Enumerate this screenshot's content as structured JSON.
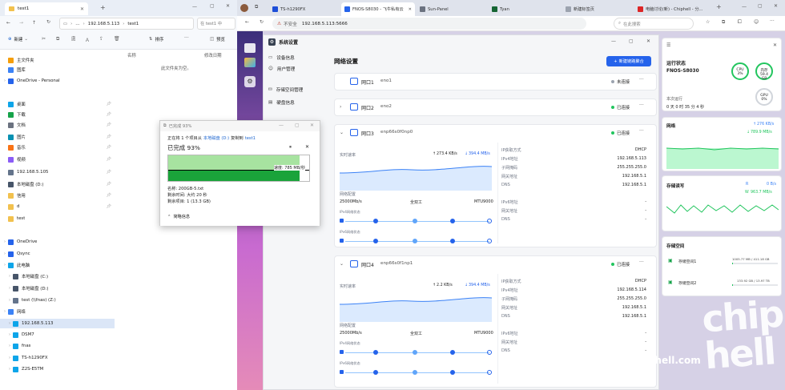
{
  "explorer": {
    "tab_title": "test1",
    "path": [
      "192.168.5.113",
      "test1"
    ],
    "search_placeholder": "在 test1 中",
    "new_label": "新建",
    "sort_label": "排序",
    "view_label": "查看",
    "preview_label": "预览",
    "col_name": "名称",
    "col_modified": "修改日期",
    "empty_text": "此文件夹为空。",
    "nav": [
      {
        "label": "主文件夹",
        "icon": "home-icon",
        "pin": false,
        "chev": false
      },
      {
        "label": "图库",
        "icon": "gallery-icon",
        "pin": false,
        "chev": false
      },
      {
        "label": "OneDrive - Personal",
        "icon": "cloud-icon",
        "pin": false,
        "chev": true
      },
      {
        "label": "桌面",
        "icon": "desktop-icon",
        "pin": true,
        "chev": false
      },
      {
        "label": "下载",
        "icon": "download-icon",
        "pin": true,
        "chev": false
      },
      {
        "label": "文档",
        "icon": "document-icon",
        "pin": true,
        "chev": false
      },
      {
        "label": "图片",
        "icon": "pictures-icon",
        "pin": true,
        "chev": false
      },
      {
        "label": "音乐",
        "icon": "music-icon",
        "pin": true,
        "chev": false
      },
      {
        "label": "视频",
        "icon": "video-icon",
        "pin": true,
        "chev": false
      },
      {
        "label": "192.168.5.105",
        "icon": "network-drive-icon",
        "pin": true,
        "chev": false
      },
      {
        "label": "本地磁盘 (D:)",
        "icon": "drive-icon",
        "pin": true,
        "chev": false
      },
      {
        "label": "信用",
        "icon": "folder-icon",
        "pin": true,
        "chev": false
      },
      {
        "label": "d",
        "icon": "folder-icon",
        "pin": true,
        "chev": false
      },
      {
        "label": "test",
        "icon": "folder-icon",
        "pin": false,
        "chev": false
      },
      {
        "label": "OneDrive",
        "icon": "cloud-icon",
        "pin": false,
        "chev": true
      },
      {
        "label": "Qsync",
        "icon": "sync-icon",
        "pin": false,
        "chev": true
      },
      {
        "label": "此电脑",
        "icon": "pc-icon",
        "pin": false,
        "chev": true
      },
      {
        "label": "本地磁盘 (C:)",
        "icon": "drive-icon",
        "pin": false,
        "chev": true
      },
      {
        "label": "本地磁盘 (D:)",
        "icon": "drive-icon",
        "pin": false,
        "chev": true
      },
      {
        "label": "test (\\\\fnas) (Z:)",
        "icon": "network-drive-icon",
        "pin": false,
        "chev": true
      },
      {
        "label": "网络",
        "icon": "network-icon",
        "pin": false,
        "chev": true
      },
      {
        "label": "192.168.5.113",
        "icon": "pc-icon",
        "pin": false,
        "chev": true
      },
      {
        "label": "DSM7",
        "icon": "pc-icon",
        "pin": false,
        "chev": true
      },
      {
        "label": "fnas",
        "icon": "pc-icon",
        "pin": false,
        "chev": true
      },
      {
        "label": "TS-h1290FX",
        "icon": "pc-icon",
        "pin": false,
        "chev": true
      },
      {
        "label": "Z2S-E5TM",
        "icon": "pc-icon",
        "pin": false,
        "chev": true
      }
    ]
  },
  "copy": {
    "title": "已完成 93%",
    "line1_pre": "正在将 1 个项目从",
    "line1_src": "本地磁盘 (D:)",
    "line1_mid": "复制到",
    "line1_dst": "test1",
    "done": "已完成 93%",
    "progress": 0.93,
    "speed": "速度: 785 MB/秒",
    "name": "名称: 200GB-5.txt",
    "remain_time": "剩余时间: 大约 20 秒",
    "remain_items": "剩余项目: 1 (13.3 GB)",
    "less": "简略信息"
  },
  "browser": {
    "tabs": [
      "TS-h1290FX",
      "FNOS-S8030 - 飞牛私有云",
      "Sun-Panel",
      "Tyan",
      "新建标签页",
      "电脑讨论(新) - Chiphell - 分..."
    ],
    "insecure": "不安全",
    "url": "192.168.5.113:5666",
    "search_placeholder": "在此搜索"
  },
  "settings": {
    "title": "系统设置",
    "menu": [
      "设备信息",
      "用户管理",
      "存储空间管理",
      "硬盘信息"
    ],
    "section": "网络设置",
    "new_bond": "新建链路聚合",
    "ports": [
      {
        "name": "网口1",
        "dev": "eno1",
        "status": "未连接",
        "status_color": "#9ca3af"
      },
      {
        "name": "网口2",
        "dev": "eno2",
        "status": "已连接",
        "status_color": "#22c55e"
      },
      {
        "name": "网口3",
        "dev": "enp66s0f0np0",
        "status": "已连接",
        "status_color": "#22c55e"
      },
      {
        "name": "网口4",
        "dev": "enp66s0f1np1",
        "status": "已连接",
        "status_color": "#22c55e"
      }
    ],
    "p3": {
      "rt": "实时速率",
      "up": "273.4 KB/s",
      "down": "394.4 MB/s",
      "cfg": "网络配置",
      "speed": "25000Mb/s",
      "duplex": "全双工",
      "mtu": "MTU9000",
      "v4": "IPv4网络状态",
      "v6": "IPv6网络状态",
      "kv": [
        [
          "IP获取方式",
          "DHCP"
        ],
        [
          "IPv4地址",
          "192.168.5.113"
        ],
        [
          "子网掩码",
          "255.255.255.0"
        ],
        [
          "网关地址",
          "192.168.5.1"
        ],
        [
          "DNS",
          "192.168.5.1"
        ]
      ],
      "kv6": [
        [
          "IPv6地址",
          "-"
        ],
        [
          "网关地址",
          "-"
        ],
        [
          "DNS",
          "-"
        ]
      ]
    },
    "p4": {
      "rt": "实时速率",
      "up": "2.2 KB/s",
      "down": "394.4 MB/s",
      "cfg": "网络配置",
      "speed": "25000Mb/s",
      "duplex": "全双工",
      "mtu": "MTU9000",
      "v4": "IPv4网络状态",
      "v6": "IPv6网络状态",
      "kv": [
        [
          "IP获取方式",
          "DHCP"
        ],
        [
          "IPv4地址",
          "192.168.5.114"
        ],
        [
          "子网掩码",
          "255.255.255.0"
        ],
        [
          "网关地址",
          "192.168.5.1"
        ],
        [
          "DNS",
          "192.168.5.1"
        ]
      ],
      "kv6": [
        [
          "IPv6地址",
          "-"
        ],
        [
          "网关地址",
          "-"
        ],
        [
          "DNS",
          "-"
        ]
      ]
    }
  },
  "panel": {
    "run": "运行状态",
    "host": "FNOS-S8030",
    "cpu_l": "CPU",
    "cpu_v": "3%",
    "mem_l": "内存",
    "mem_v": "59.4 GB",
    "uptime_l": "本次运行",
    "uptime_v": "0 天 0 时 35 分 4 秒",
    "gpu_l": "GPU",
    "gpu_v": "0%",
    "net": "网络",
    "net_up": "276 KB/s",
    "net_down": "789.9 MB/s",
    "disk": "存储读写",
    "disk_r": "0",
    "disk_w": "963.7 MB/s",
    "disk_r_unit": "0 B/s",
    "storage": "存储空间",
    "s1": {
      "name": "存储空间1",
      "val": "1005.77 MB / 411.18 GB",
      "frac": 0.01
    },
    "s2": {
      "name": "存储空间2",
      "val": "133.92 GB / 13.97 TB",
      "frac": 0.01
    }
  },
  "watermark": "www.chiphell.com",
  "logo_text": "chip hell"
}
